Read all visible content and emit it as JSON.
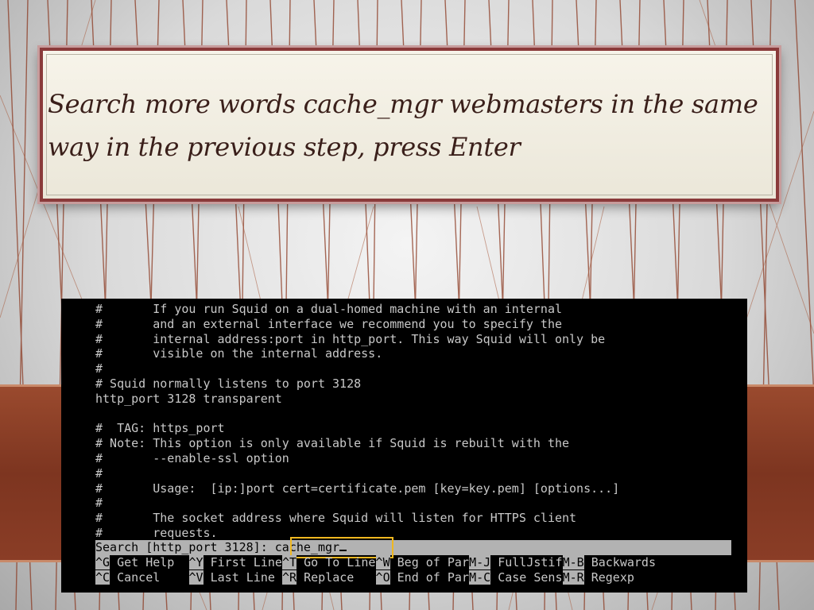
{
  "slide": {
    "title": "Search more words cache_mgr webmasters in the same way in the previous step, press Enter"
  },
  "terminal": {
    "lines": [
      "#       If you run Squid on a dual-homed machine with an internal",
      "#       and an external interface we recommend you to specify the",
      "#       internal address:port in http_port. This way Squid will only be",
      "#       visible on the internal address.",
      "#",
      "# Squid normally listens to port 3128",
      "http_port 3128 transparent",
      "",
      "#  TAG: https_port",
      "# Note: This option is only available if Squid is rebuilt with the",
      "#       --enable-ssl option",
      "#",
      "#       Usage:  [ip:]port cert=certificate.pem [key=key.pem] [options...]",
      "#",
      "#       The socket address where Squid will listen for HTTPS client",
      "#       requests."
    ],
    "search": {
      "prompt": "Search [http_port 3128]: ",
      "value": "cache_mgr"
    },
    "shortcuts_row1": [
      {
        "key": "^G",
        "label": " Get Help"
      },
      {
        "key": "^Y",
        "label": " First Line"
      },
      {
        "key": "^T",
        "label": " Go To Line"
      },
      {
        "key": "^W",
        "label": " Beg of Par"
      },
      {
        "key": "M-J",
        "label": " FullJstif"
      },
      {
        "key": "M-B",
        "label": " Backwards"
      }
    ],
    "shortcuts_row2": [
      {
        "key": "^C",
        "label": " Cancel"
      },
      {
        "key": "^V",
        "label": " Last Line"
      },
      {
        "key": "^R",
        "label": " Replace"
      },
      {
        "key": "^O",
        "label": " End of Par"
      },
      {
        "key": "M-C",
        "label": " Case Sens"
      },
      {
        "key": "M-R",
        "label": " Regexp"
      }
    ],
    "colors": {
      "background": "#000000",
      "text": "#c8c8c8",
      "statusbar": "#b2b2b2",
      "highlight": "#f0b820"
    }
  }
}
